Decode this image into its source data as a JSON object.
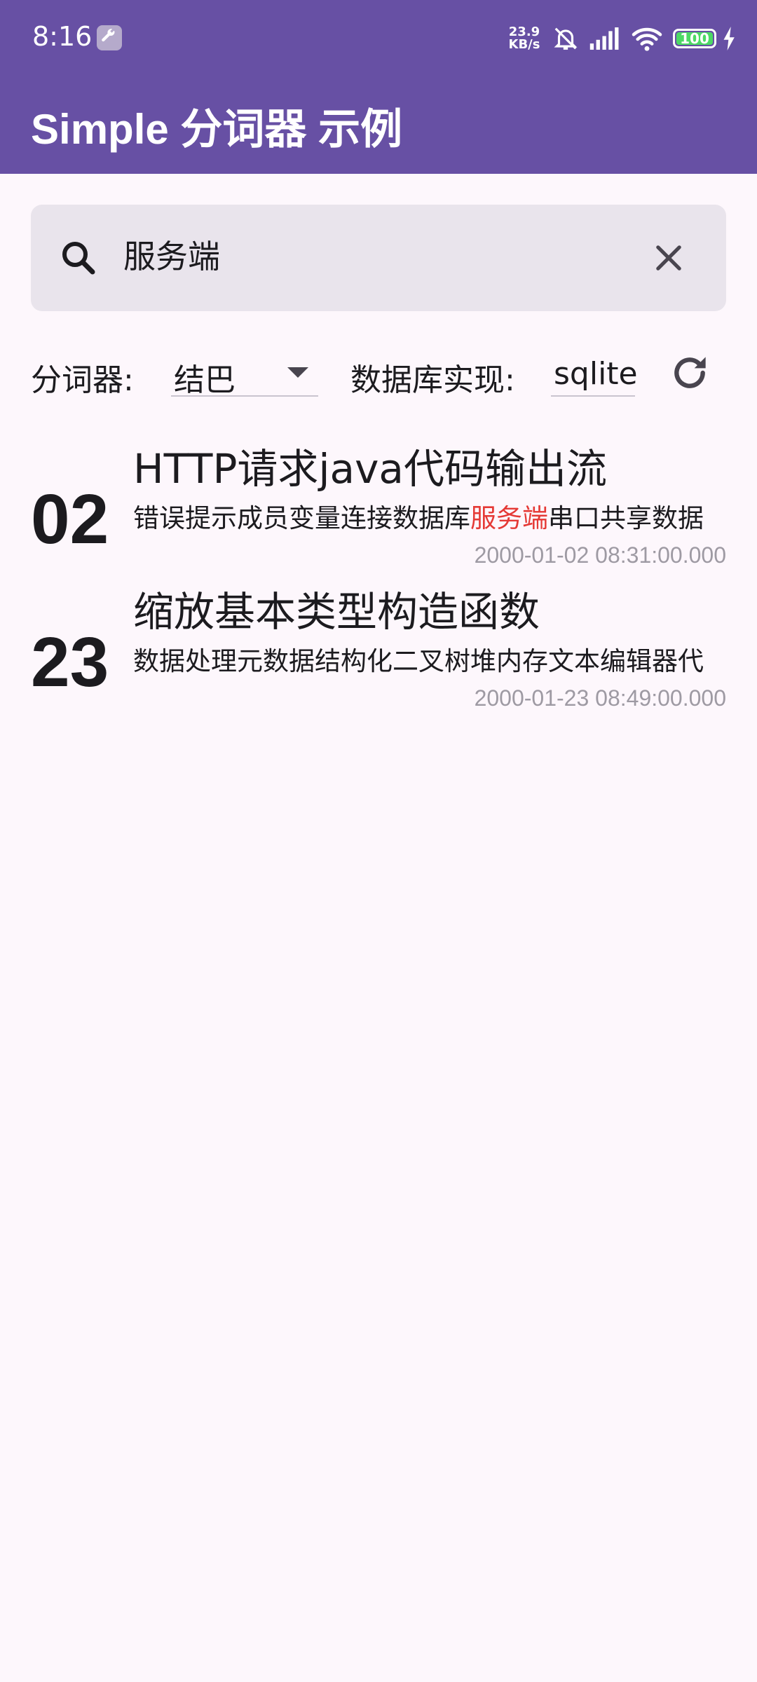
{
  "status_bar": {
    "time": "8:16",
    "network_speed_value": "23.9",
    "network_speed_unit": "KB/s",
    "battery": "100",
    "icons": [
      "wrench-icon",
      "bell-off-icon",
      "signal-icon",
      "wifi-icon",
      "battery-icon",
      "charging-icon"
    ]
  },
  "app_bar": {
    "title": "Simple 分词器 示例"
  },
  "search": {
    "value": "服务端",
    "icons": [
      "search-icon",
      "clear-icon"
    ]
  },
  "controls": {
    "tokenizer_label": "分词器:",
    "tokenizer_value": "结巴",
    "db_label": "数据库实现:",
    "db_value": "sqlite",
    "refresh_icon": "refresh-icon"
  },
  "results": [
    {
      "day": "02",
      "title": "HTTP请求java代码输出流",
      "content_before": "错误提示成员变量连接数据库",
      "content_highlight": "服务端",
      "content_after": "串口共享数据",
      "time": "2000-01-02 08:31:00.000"
    },
    {
      "day": "23",
      "title": "缩放基本类型构造函数",
      "content_before": "数据处理元数据结构化二叉树堆内存文本编辑器代",
      "content_highlight": "",
      "content_after": "",
      "time": "2000-01-23 08:49:00.000"
    }
  ],
  "colors": {
    "primary": "#6750A4",
    "background": "#FDF7FC",
    "search_bg": "#E9E4EC",
    "highlight": "#E53935",
    "timestamp": "#9E9AA3"
  }
}
